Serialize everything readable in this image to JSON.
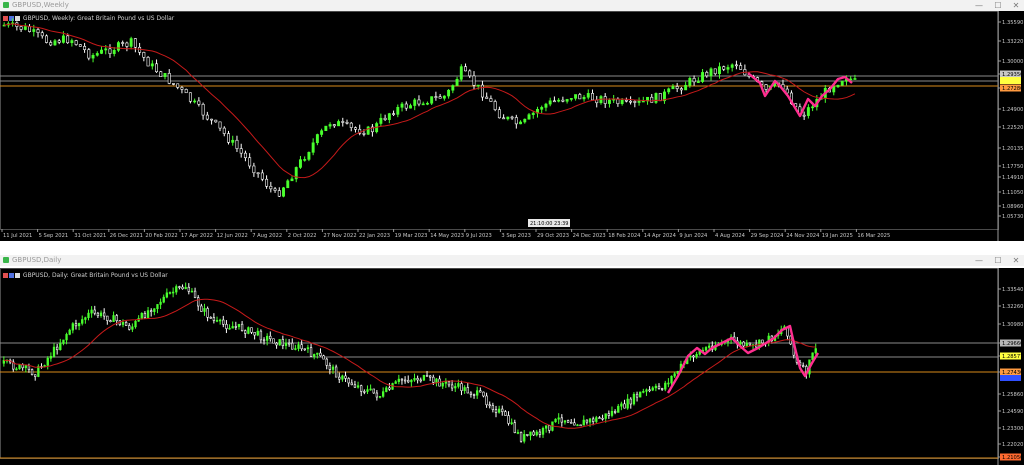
{
  "colors": {
    "bull": "#49ff2e",
    "bear": "#ffffff",
    "ma": "#c61a1a",
    "pink": "#ff2d8f",
    "frame": "#4a4a4a",
    "axis_text": "#c8c8c8",
    "line_gray": "#8a8a8a",
    "line_orange": "#d88a1a",
    "line_yellow": "#ffff40",
    "line_red": "#ff3b2e",
    "line_blue": "#3050ff"
  },
  "weekly": {
    "title": "GBPUSD,Weekly",
    "label": "GBPUSD, Weekly:  Great Britain Pound vs US Dollar",
    "icons": [
      "red-flag-icon",
      "blue-flag-icon",
      "white-flag-icon"
    ],
    "prices": [
      "1.35590",
      "1.33220",
      "1.30000",
      "1.29350",
      "1.27280",
      "1.24900",
      "1.22520",
      "1.20135",
      "1.17750",
      "1.14910",
      "1.11050",
      "1.08960",
      "1.05730"
    ],
    "dates": [
      "11 Jul 2021",
      "5 Sep 2021",
      "31 Oct 2021",
      "26 Dec 2021",
      "20 Feb 2022",
      "17 Apr 2022",
      "12 Jun 2022",
      "7 Aug 2022",
      "2 Oct 2022",
      "27 Nov 2022",
      "22 Jan 2023",
      "19 Mar 2023",
      "14 May 2023",
      "9 Jul 2023",
      "3 Sep 2023",
      "29 Oct 2023",
      "24 Dec 2023",
      "18 Feb 2024",
      "14 Apr 2024",
      "9 Jun 2024",
      "4 Aug 2024",
      "29 Sep 2024",
      "24 Nov 2024",
      "19 Jan 2025",
      "16 Mar 2025"
    ],
    "marker": "21:10:00  23:39"
  },
  "daily": {
    "title": "GBPUSD,Daily",
    "label": "GBPUSD, Daily:  Great Britain Pound vs US Dollar",
    "icons": [
      "red-flag-icon",
      "blue-flag-icon",
      "white-flag-icon"
    ],
    "prices": [
      "1.33540",
      "1.32260",
      "1.30980",
      "1.29660",
      "1.28577",
      "1.27430",
      "1.25860",
      "1.24590",
      "1.23300",
      "1.22020",
      "1.21050"
    ]
  },
  "controls": {
    "minimize": "—",
    "maximize": "☐",
    "close": "✕"
  }
}
